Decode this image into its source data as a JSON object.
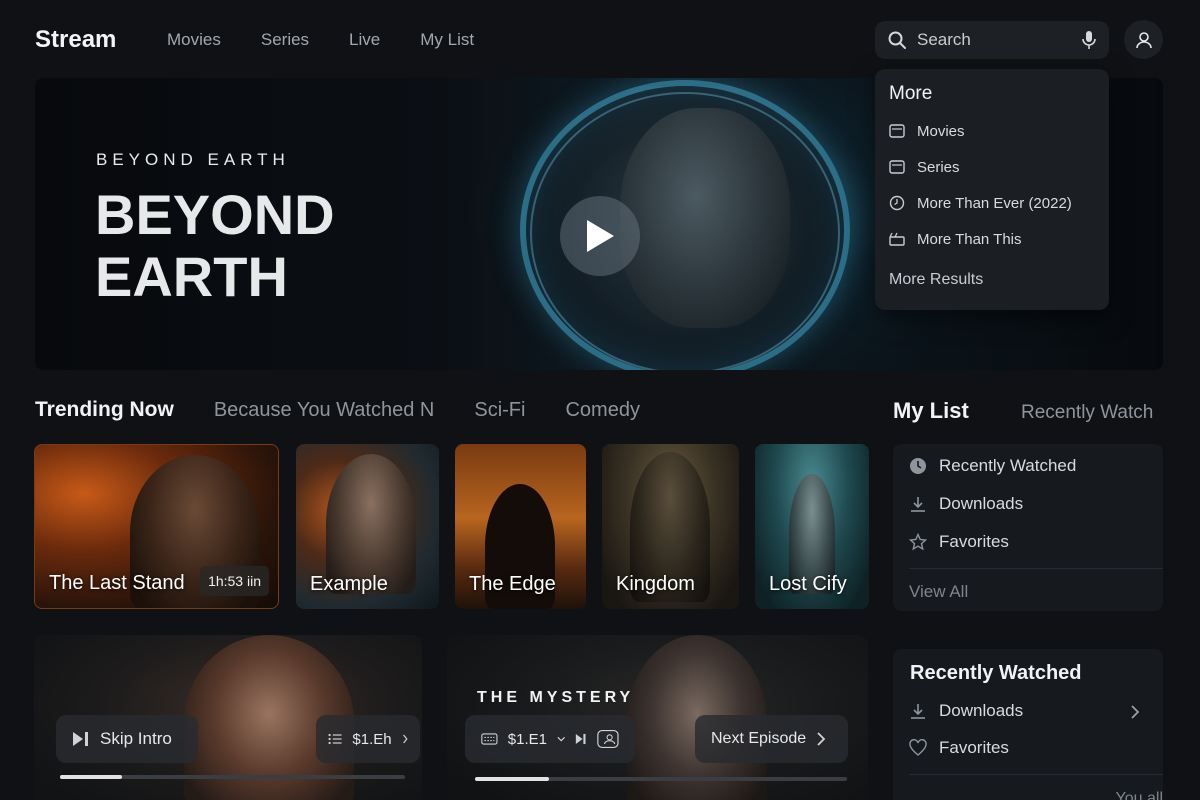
{
  "app": {
    "title": "Stream"
  },
  "nav": {
    "items": [
      "Movies",
      "Series",
      "Live",
      "My List"
    ]
  },
  "search": {
    "placeholder": "Search"
  },
  "dropdown": {
    "title": "More",
    "items": [
      {
        "label": "Movies",
        "icon": "film-icon"
      },
      {
        "label": "Series",
        "icon": "tv-icon"
      },
      {
        "label": "More Than Ever (2022)",
        "icon": "clock-icon"
      },
      {
        "label": "More Than This",
        "icon": "clapper-icon"
      }
    ],
    "more_results": "More Results"
  },
  "hero": {
    "kicker": "BEYOND EARTH",
    "title": "BEYOND EARTH"
  },
  "rows": {
    "tabs": [
      "Trending Now",
      "Because You Watched N",
      "Sci-Fi",
      "Comedy"
    ]
  },
  "cards": [
    {
      "title": "The Last Stand",
      "duration": "1h:53 iin"
    },
    {
      "title": "Example"
    },
    {
      "title": "The Edge"
    },
    {
      "title": "Kingdom"
    },
    {
      "title": "Lost Cify"
    }
  ],
  "my_list": {
    "heading": "My List",
    "tab": "Recently Watch",
    "items": [
      {
        "label": "Recently Watched",
        "icon": "clock-icon"
      },
      {
        "label": "Downloads",
        "icon": "download-icon"
      },
      {
        "label": "Favorites",
        "icon": "star-icon"
      }
    ],
    "view_all": "View All"
  },
  "recent_panel": {
    "title": "Recently Watched",
    "items": [
      {
        "label": "Downloads",
        "icon": "download-icon"
      },
      {
        "label": "Favorites",
        "icon": "heart-icon"
      }
    ],
    "footer": "You all"
  },
  "player1": {
    "skip_label": "Skip Intro",
    "episode_label": "$1.Eh",
    "progress": 0.18
  },
  "player2": {
    "title": "THE MYSTERY",
    "episode_label": "$1.E1",
    "next_label": "Next Episode",
    "progress": 0.2
  },
  "colors": {
    "background": "#0f1114",
    "accent_hero": "#46b4dc"
  }
}
